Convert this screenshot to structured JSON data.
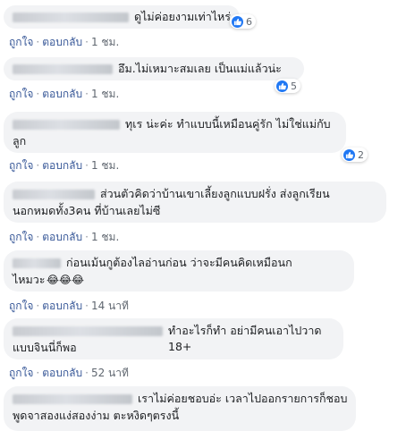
{
  "labels": {
    "like": "ถูกใจ",
    "reply": "ตอบกลับ",
    "dot": "·"
  },
  "colors": {
    "bubble": "#f2f3f5",
    "link": "#385898",
    "like_blue": "#2078f4"
  },
  "comments": [
    {
      "text": "ดูไม่ค่อยงามเท่าไหร่",
      "time": "1 ชม.",
      "reactions": "6"
    },
    {
      "text": "อึม.ไม่เหมาะสมเลย เป็นแม่แล้วน่ะ",
      "time": "1 ชม.",
      "reactions": "5"
    },
    {
      "line1": "ทุเร  น่ะค่ะ ทำแบบนี้เหมือนคู่รัก ไม่ใช่แม่กับ",
      "line2": "ลูก",
      "time": "1 ชม.",
      "reactions": "2"
    },
    {
      "line1": "ส่วนตัวคิดว่าบ้านเขาเลี้ยงลูกแบบฝรั่ง ส่งลูกเรียน",
      "line2": "นอกหมดทั้ง3คน ที่บ้านเลยไม่ซี",
      "time": "1 ชม."
    },
    {
      "line1": "ก่อนเม้นกูต้องไลอ่านก่อน ว่าจะมีคนคิดเหมือนก",
      "line2": "ไหมวะ",
      "emoji": "😂😂😂",
      "time": "14 นาที"
    },
    {
      "line1": "ทำอะไรก็ทำ อย่ามีคนเอาไปวาด 18+",
      "line2": "แบบจินนี่ก็พอ",
      "time": "52 นาที"
    },
    {
      "line1": "เราไม่ค่อยชอบอ่ะ เวลาไปออกรายการก็ชอบ",
      "line2": "พูดจาสองแง่สองง่าม ตะหงิดๆตรงนี้"
    }
  ]
}
